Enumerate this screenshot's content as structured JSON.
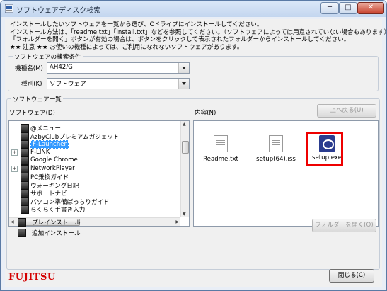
{
  "window": {
    "title": "ソフトウェアディスク検索",
    "minimize": "─",
    "maximize": "□",
    "close": "✕"
  },
  "instructions": [
    "インストールしたいソフトウェアを一覧から選び、Cドライブにインストールしてください。",
    "インストール方法は、「readme.txt」「install.txt」などを参照してください。（ソフトウェアによっては用意されていない場合もあります）",
    "「フォルダーを開く」ボタンが有効の場合は、ボタンをクリックして表示されたフォルダーからインストールしてください。",
    "★★ 注意 ★★ お使いの機種によっては、ご利用になれないソフトウェアがあります。"
  ],
  "search": {
    "group_label": "ソフトウェアの検索条件",
    "model_label": "機種名(M)",
    "model_value": "AH42/G",
    "type_label": "種別(K)",
    "type_value": "ソフトウェア"
  },
  "list": {
    "group_label": "ソフトウェア一覧",
    "software_label": "ソフトウェア(D)",
    "contents_label": "内容(N)",
    "back_button": "上へ戻る(U)",
    "open_folder_button": "フォルダーを開く(O)",
    "tree": [
      {
        "label": "@メニュー",
        "expand": false
      },
      {
        "label": "AzbyClubプレミアムガジェット",
        "expand": false
      },
      {
        "label": "F-Launcher",
        "expand": false,
        "selected": true
      },
      {
        "label": "F-LINK",
        "expand": true
      },
      {
        "label": "Google Chrome",
        "expand": false
      },
      {
        "label": "NetworkPlayer",
        "expand": true
      },
      {
        "label": "PC乗換ガイド",
        "expand": false
      },
      {
        "label": "ウォーキング日記",
        "expand": false
      },
      {
        "label": "サポートナビ",
        "expand": false
      },
      {
        "label": "パソコン準備ばっちりガイド",
        "expand": false
      },
      {
        "label": "らくらく手書き入力",
        "expand": false
      }
    ],
    "files": [
      {
        "name": "Readme.txt",
        "icon": "text-file-icon"
      },
      {
        "name": "setup(64).iss",
        "icon": "iss-file-icon"
      },
      {
        "name": "setup.exe",
        "icon": "setup-exe-icon"
      }
    ],
    "legend_preinstall": "プレインストール",
    "legend_addinstall": "追加インストール"
  },
  "footer": {
    "logo": "FUJITSU",
    "close_button": "閉じる(C)"
  },
  "colors": {
    "highlight": "#e00000",
    "selection": "#3399ff",
    "logo": "#d40000"
  }
}
